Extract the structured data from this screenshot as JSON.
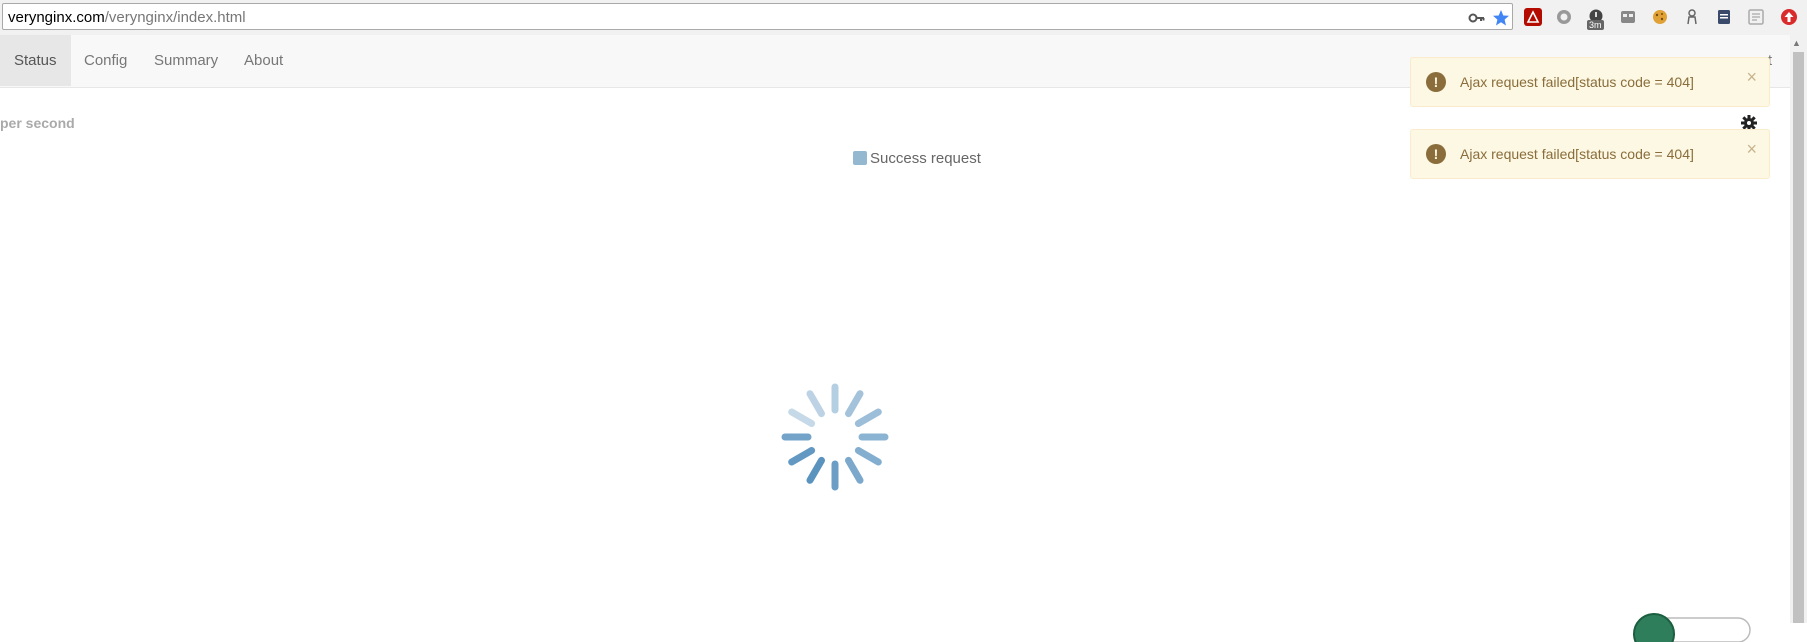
{
  "browser": {
    "url_host": "verynginx.com",
    "url_path": "/verynginx/index.html",
    "extension_badge": "3m"
  },
  "nav": {
    "tabs": [
      {
        "label": "Status",
        "active": true
      },
      {
        "label": "Config",
        "active": false
      },
      {
        "label": "Summary",
        "active": false
      },
      {
        "label": "About",
        "active": false
      }
    ],
    "right_partial": "t"
  },
  "chart": {
    "title": "per second",
    "legend_label": "Success request"
  },
  "toasts": [
    {
      "icon": "!",
      "message": "Ajax request failed[status code = 404]",
      "close": "×"
    },
    {
      "icon": "!",
      "message": "Ajax request failed[status code = 404]",
      "close": "×"
    }
  ],
  "colors": {
    "accent": "#337ab7",
    "spinner": "#5b93bf",
    "warning_text": "#8a6d3b",
    "warning_bg": "#fcf8e3"
  }
}
